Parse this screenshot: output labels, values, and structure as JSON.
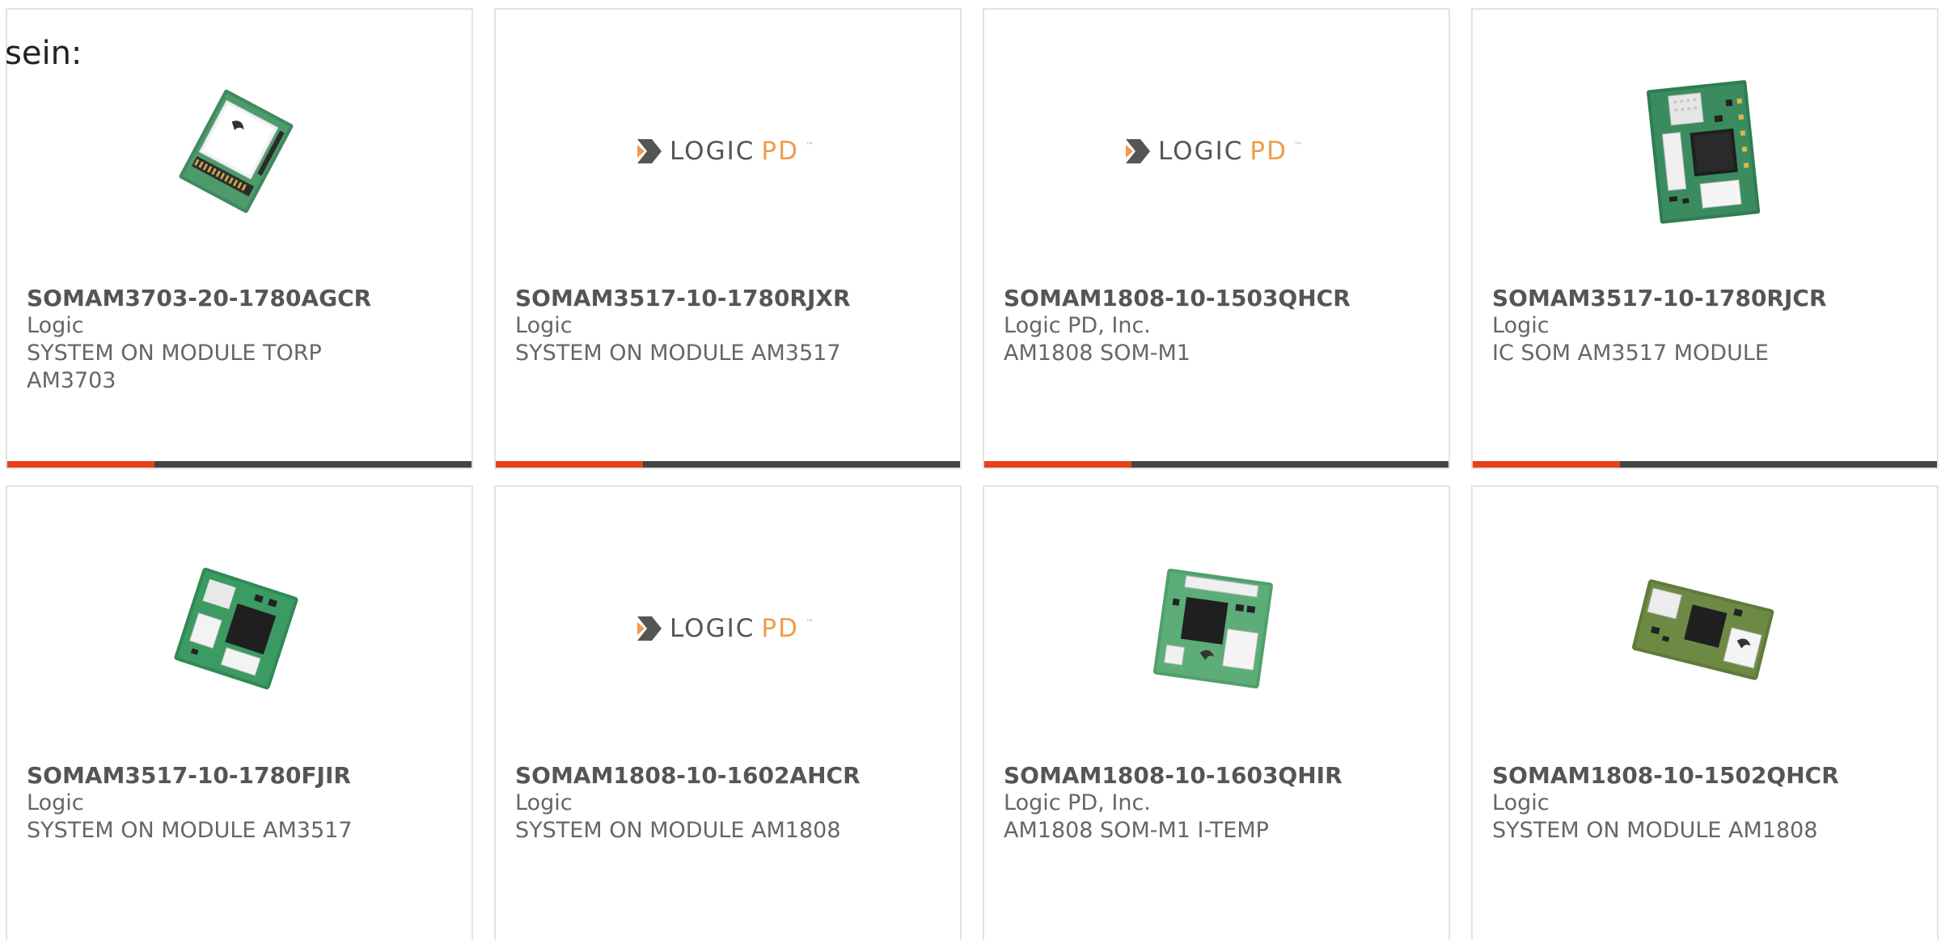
{
  "heading": "sein:",
  "colors": {
    "accent": "#e8411c",
    "bar_dark": "#444444",
    "border": "#e3e3e3",
    "logo_orange": "#f29a4a",
    "logo_gray": "#555555",
    "pcb_green": "#2f8a55"
  },
  "logo_text": {
    "word_a": "LOGIC",
    "word_b": "PD",
    "tm": "™"
  },
  "products": [
    {
      "part_no": "SOMAM3703-20-1780AGCR",
      "manufacturer": "Logic",
      "description": "SYSTEM ON MODULE TORP AM3703",
      "image": "board-angled-icon"
    },
    {
      "part_no": "SOMAM3517-10-1780RJXR",
      "manufacturer": "Logic",
      "description": "SYSTEM ON MODULE AM3517",
      "image": "logic-pd-logo"
    },
    {
      "part_no": "SOMAM1808-10-1503QHCR",
      "manufacturer": "Logic PD, Inc.",
      "description": "AM1808 SOM-M1",
      "image": "logic-pd-logo"
    },
    {
      "part_no": "SOMAM3517-10-1780RJCR",
      "manufacturer": "Logic",
      "description": "IC SOM AM3517 MODULE",
      "image": "board-upright-icon"
    },
    {
      "part_no": "SOMAM3517-10-1780FJIR",
      "manufacturer": "Logic",
      "description": "SYSTEM ON MODULE AM3517",
      "image": "board-flat-icon"
    },
    {
      "part_no": "SOMAM1808-10-1602AHCR",
      "manufacturer": "Logic",
      "description": "SYSTEM ON MODULE AM1808",
      "image": "logic-pd-logo"
    },
    {
      "part_no": "SOMAM1808-10-1603QHIR",
      "manufacturer": "Logic PD, Inc.",
      "description": "AM1808 SOM-M1 I-TEMP",
      "image": "board-square-icon"
    },
    {
      "part_no": "SOMAM1808-10-1502QHCR",
      "manufacturer": "Logic",
      "description": "SYSTEM ON MODULE AM1808",
      "image": "board-wide-icon"
    }
  ]
}
